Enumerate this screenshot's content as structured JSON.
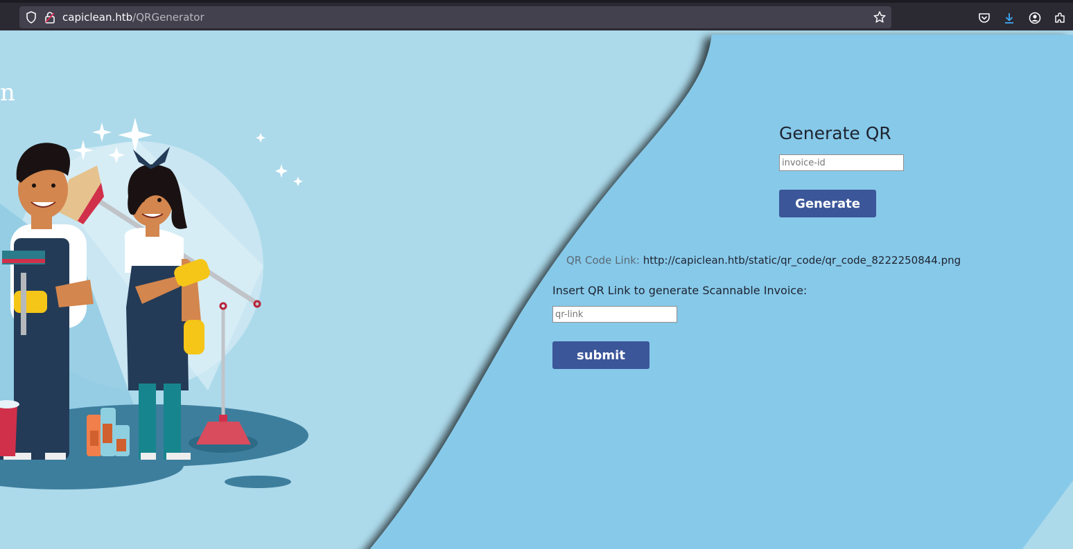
{
  "browser": {
    "url_host": "capiclean.htb",
    "url_path": "/QRGenerator"
  },
  "brand": {
    "partial_text": "n"
  },
  "generate_section": {
    "title": "Generate QR",
    "invoice_placeholder": "invoice-id",
    "button_label": "Generate"
  },
  "qr_result": {
    "label": "QR Code Link:",
    "link": "http://capiclean.htb/static/qr_code/qr_code_8222250844.png"
  },
  "invoice_section": {
    "label": "Insert QR Link to generate Scannable Invoice:",
    "link_placeholder": "qr-link",
    "button_label": "submit"
  },
  "colors": {
    "page_bg_light": "#acdaeb",
    "page_bg_right": "#87c9e9",
    "button": "#3b5699",
    "text_dark": "#1d2330"
  }
}
